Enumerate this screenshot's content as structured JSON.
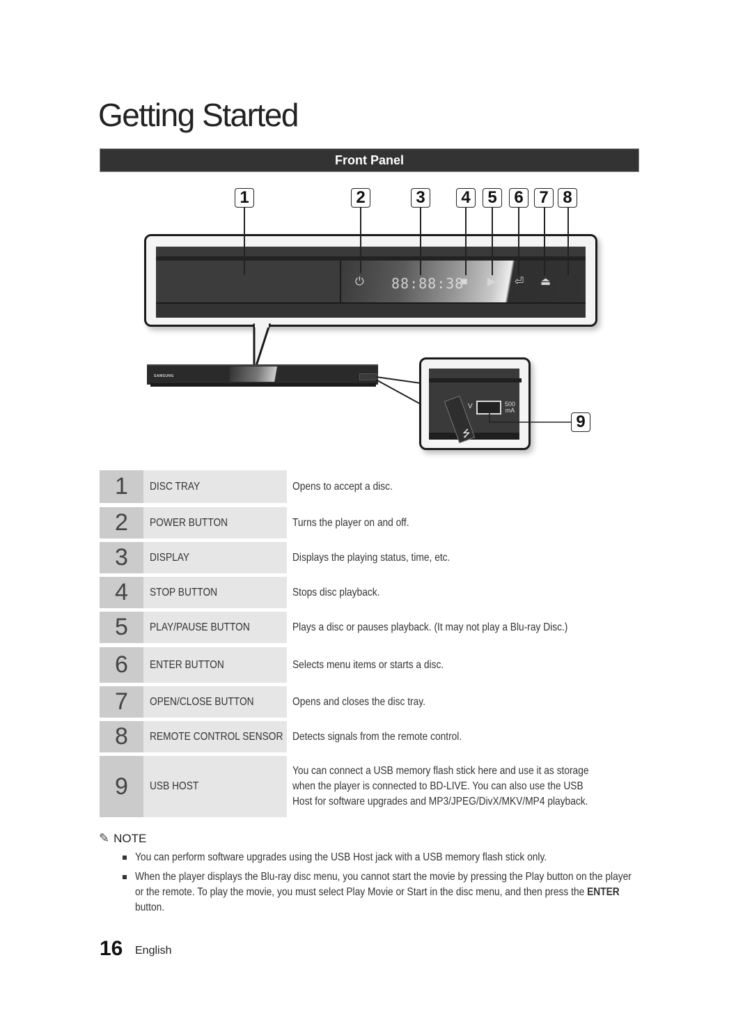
{
  "page": {
    "title": "Getting Started",
    "section": "Front Panel",
    "page_number": "16",
    "language": "English"
  },
  "diagram": {
    "callouts": [
      "1",
      "2",
      "3",
      "4",
      "5",
      "6",
      "7",
      "8",
      "9"
    ],
    "display_readout": "88:88:38",
    "player_brand": "SAMSUNG",
    "usb_voltage_label": "V",
    "usb_current_label_line1": "500",
    "usb_current_label_line2": "mA",
    "icons": [
      "power-icon",
      "stop-icon",
      "play-pause-icon",
      "enter-icon",
      "eject-icon",
      "usb-icon"
    ]
  },
  "parts": [
    {
      "num": "1",
      "name": "DISC TRAY",
      "desc": "Opens to accept a disc."
    },
    {
      "num": "2",
      "name": "POWER BUTTON",
      "desc": "Turns the player on and off."
    },
    {
      "num": "3",
      "name": "DISPLAY",
      "desc": "Displays the playing status, time, etc."
    },
    {
      "num": "4",
      "name": "STOP BUTTON",
      "desc": "Stops disc playback."
    },
    {
      "num": "5",
      "name": "PLAY/PAUSE BUTTON",
      "desc": "Plays a disc or pauses playback. (It may not play a Blu-ray Disc.)"
    },
    {
      "num": "6",
      "name": "ENTER BUTTON",
      "desc": "Selects menu items or starts a disc."
    },
    {
      "num": "7",
      "name": "OPEN/CLOSE BUTTON",
      "desc": "Opens and closes the disc tray."
    },
    {
      "num": "8",
      "name": "REMOTE CONTROL SENSOR",
      "desc": "Detects signals from the remote control."
    },
    {
      "num": "9",
      "name": "USB HOST",
      "desc": "You can connect a USB memory flash stick here and use it as storage when the player is connected to BD-LIVE. You can also use the USB Host for software upgrades and MP3/JPEG/DivX/MKV/MP4 playback."
    }
  ],
  "note": {
    "label": "NOTE",
    "items": [
      "You can perform software upgrades using the USB Host jack with a USB memory flash stick only.",
      "When the player displays the Blu-ray disc menu, you cannot start the movie by pressing the Play button on the player or the remote. To play the movie, you must select Play Movie or Start in the disc menu, and then press the ",
      "ENTER",
      " button."
    ]
  }
}
